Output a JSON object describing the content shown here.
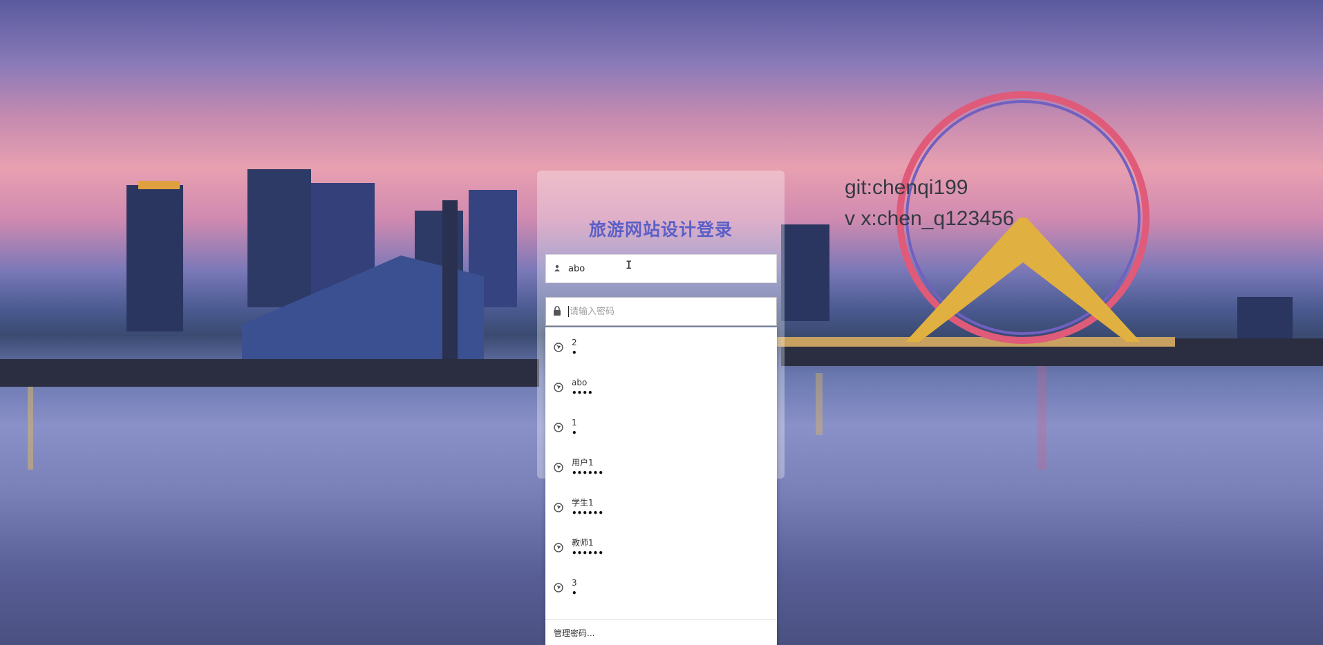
{
  "page": {
    "title": "旅游网站设计登录",
    "overlay_line1": "git:chenqi199",
    "overlay_line2": "v x:chen_q123456"
  },
  "username": {
    "value": "abo",
    "icon": "user-icon"
  },
  "password": {
    "value": "",
    "placeholder": "请输入密码",
    "icon": "lock-icon"
  },
  "autocomplete": {
    "items": [
      {
        "name": "2",
        "password_mask": "•"
      },
      {
        "name": "abo",
        "password_mask": "••••"
      },
      {
        "name": "1",
        "password_mask": "•"
      },
      {
        "name": "用户1",
        "password_mask": "••••••"
      },
      {
        "name": "学生1",
        "password_mask": "••••••"
      },
      {
        "name": "教师1",
        "password_mask": "••••••"
      },
      {
        "name": "3",
        "password_mask": "•"
      }
    ],
    "manage_label": "管理密码..."
  },
  "colors": {
    "title": "#5b5fc7"
  }
}
